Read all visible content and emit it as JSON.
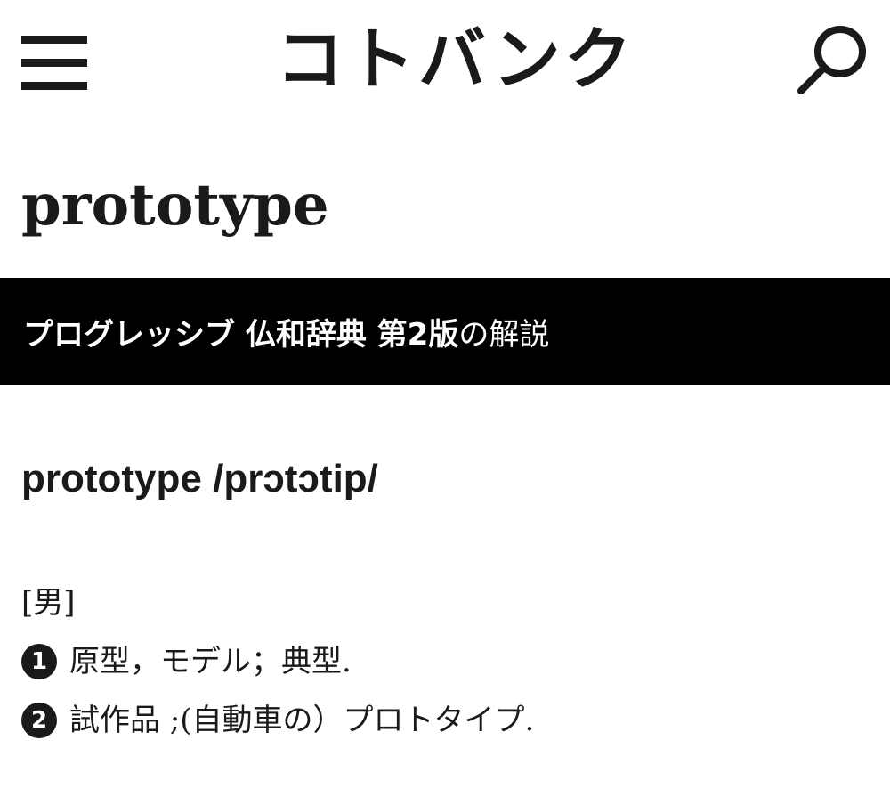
{
  "header": {
    "logo_text": "コトバンク",
    "menu_icon": "hamburger-menu-icon",
    "search_icon": "search-icon"
  },
  "word": {
    "title": "prototype"
  },
  "source": {
    "dictionary_name": "プログレッシブ 仏和辞典 第2版",
    "suffix": "の解説"
  },
  "entry": {
    "headword": "prototype /prɔtɔtip/",
    "gender": "[男]",
    "senses": [
      {
        "number": "1",
        "text": "原型，モデル；典型."
      },
      {
        "number": "2",
        "text": "試作品 ;(自動車の）プロトタイプ."
      }
    ]
  }
}
